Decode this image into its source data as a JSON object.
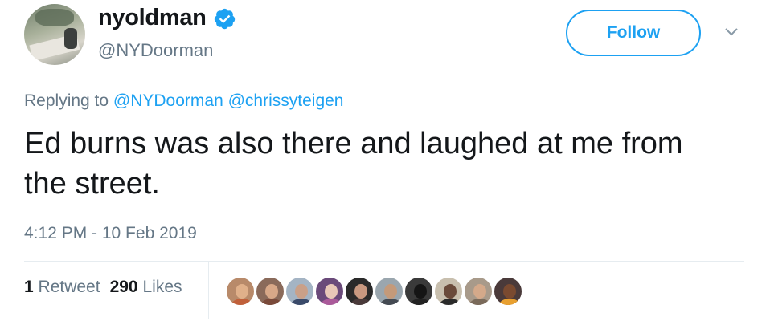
{
  "user": {
    "display_name": "nyoldman",
    "handle": "@NYDoorman",
    "verified": true,
    "verified_color": "#1da1f2"
  },
  "actions": {
    "follow_label": "Follow",
    "menu_icon": "chevron-down-icon"
  },
  "reply": {
    "prefix": "Replying to",
    "mentions": [
      "@NYDoorman",
      "@chrissyteigen"
    ]
  },
  "tweet": {
    "text": "Ed burns was also there and laughed at me from the street.",
    "timestamp": "4:12 PM - 10 Feb 2019"
  },
  "stats": {
    "retweets_count": "1",
    "retweets_label": "Retweet",
    "likes_count": "290",
    "likes_label": "Likes"
  },
  "likers": [
    {
      "bg": "#b88a6a",
      "face": "#e0b08a",
      "body": "#c0603a"
    },
    {
      "bg": "#8a6a5a",
      "face": "#d8a888",
      "body": "#7a4a3a"
    },
    {
      "bg": "#a4b4c4",
      "face": "#caa088",
      "body": "#3a4a6a"
    },
    {
      "bg": "#6a4a7a",
      "face": "#e8c8b8",
      "body": "#aa5a9a"
    },
    {
      "bg": "#2a2a2a",
      "face": "#c89880",
      "body": "#4a3a3a"
    },
    {
      "bg": "#9aa6ae",
      "face": "#c49a7a",
      "body": "#444a52"
    },
    {
      "bg": "#3a3a3a",
      "face": "#151515",
      "body": "#222222"
    },
    {
      "bg": "#c8bfae",
      "face": "#6a4a3a",
      "body": "#2a2a2a"
    },
    {
      "bg": "#a89a8a",
      "face": "#d4a98a",
      "body": "#7a6a5a"
    },
    {
      "bg": "#4a3a3a",
      "face": "#7a4a30",
      "body": "#e8a030"
    }
  ]
}
